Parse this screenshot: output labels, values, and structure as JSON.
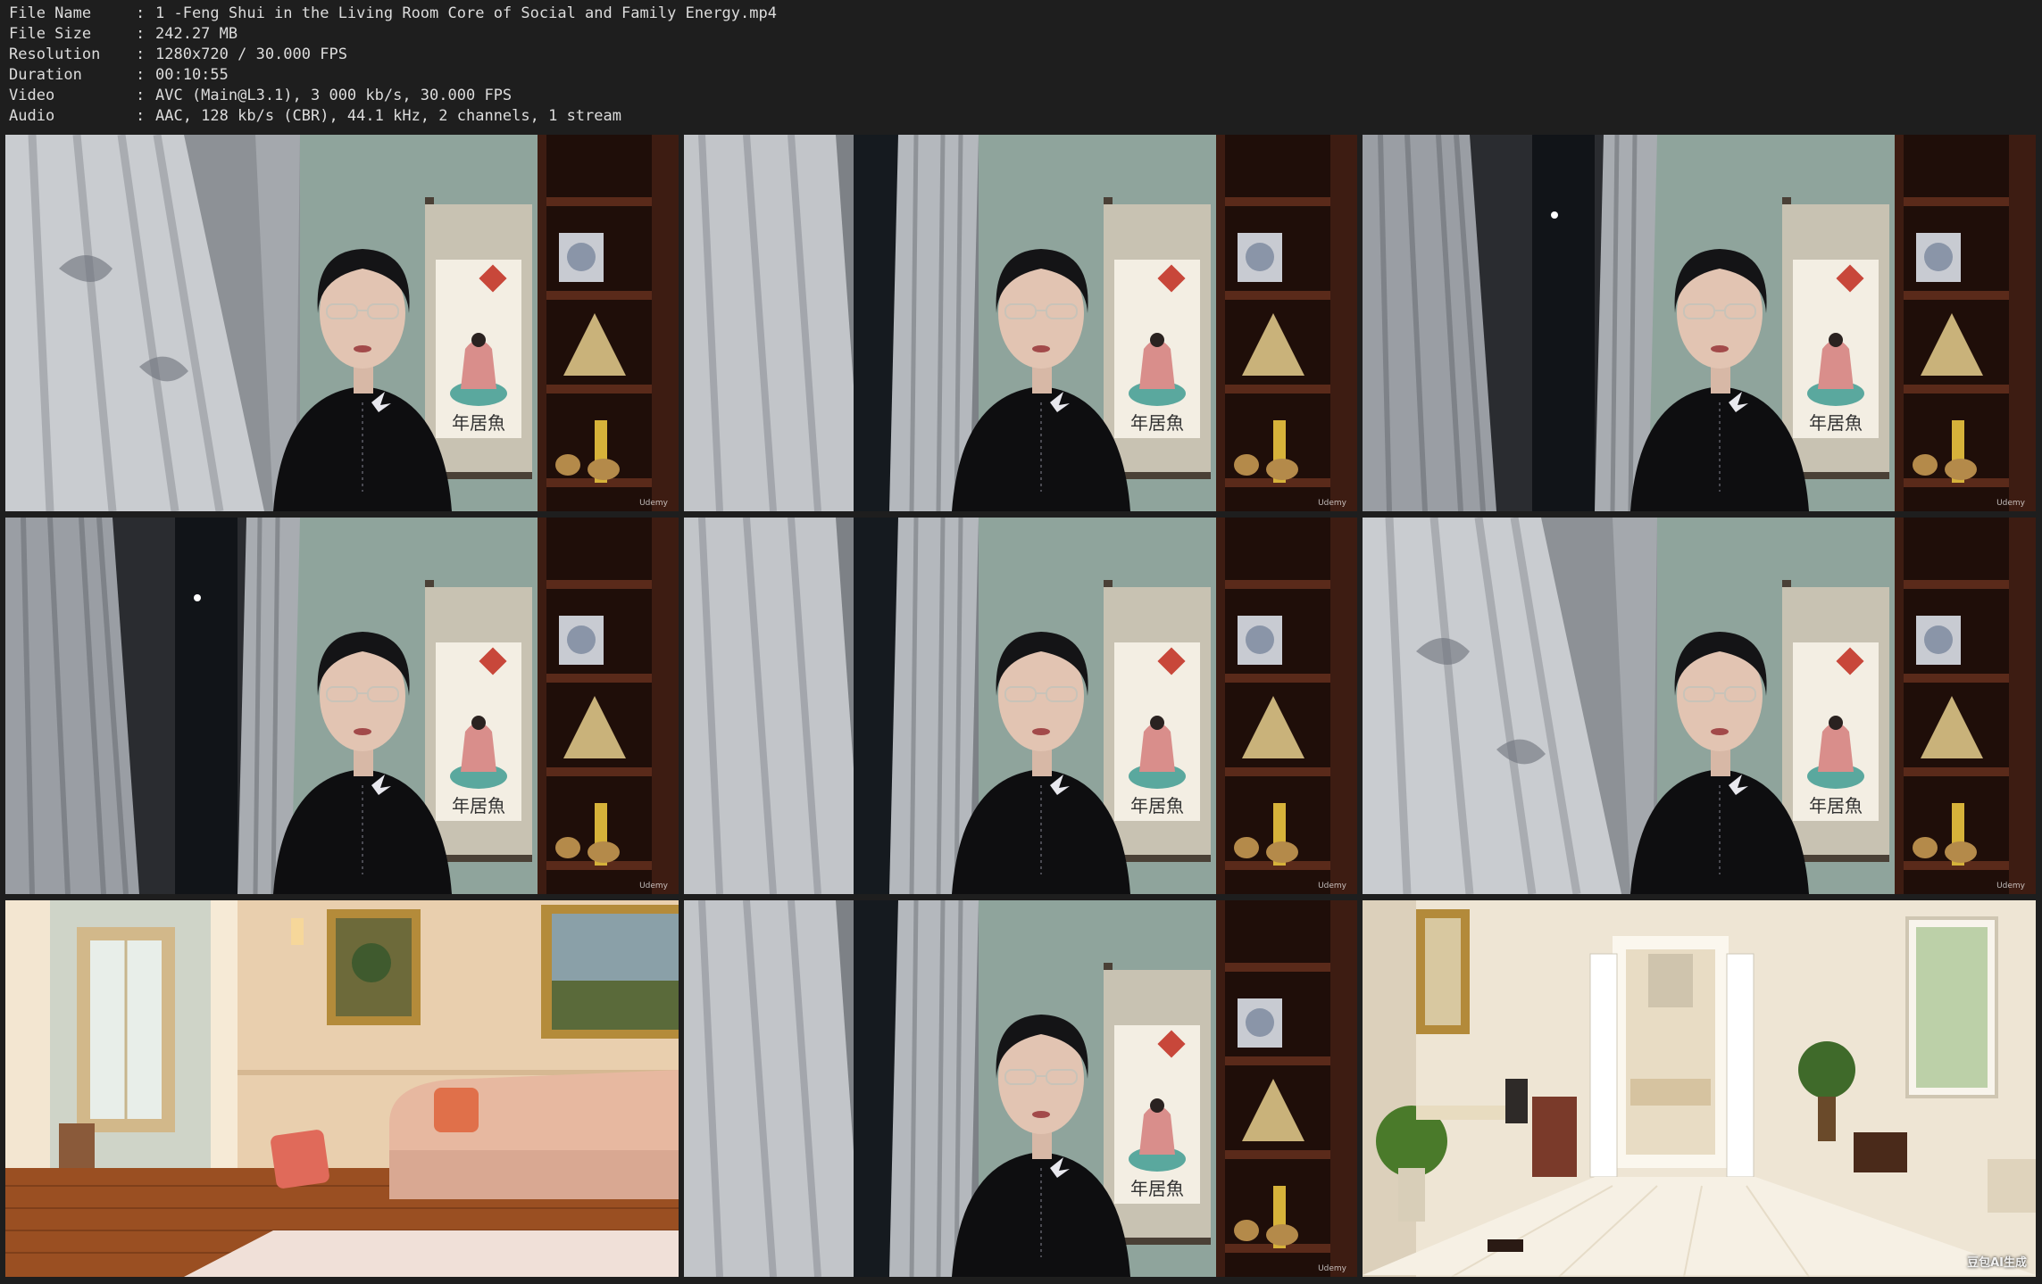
{
  "info": [
    {
      "label": "File Name",
      "value": "1 -Feng Shui in the Living Room Core of Social and Family Energy.mp4"
    },
    {
      "label": "File Size",
      "value": "242.27 MB"
    },
    {
      "label": "Resolution",
      "value": "1280x720 / 30.000 FPS"
    },
    {
      "label": "Duration",
      "value": "00:10:55"
    },
    {
      "label": "Video",
      "value": "AVC (Main@L3.1), 3 000 kb/s, 30.000 FPS"
    },
    {
      "label": "Audio",
      "value": "AAC, 128 kb/s (CBR), 44.1 kHz, 2 channels, 1 stream"
    }
  ],
  "separator": ":",
  "watermark": "Udemy",
  "ai_badge": "豆包AI生成",
  "scroll_chars": "年居魚",
  "colors": {
    "background": "#1e1e1e",
    "text": "#dcdcdc",
    "wall": "#8fa49c",
    "shelf": "#3d1c12",
    "curtain": "#b9bcc0",
    "dress": "#0e0e10"
  }
}
